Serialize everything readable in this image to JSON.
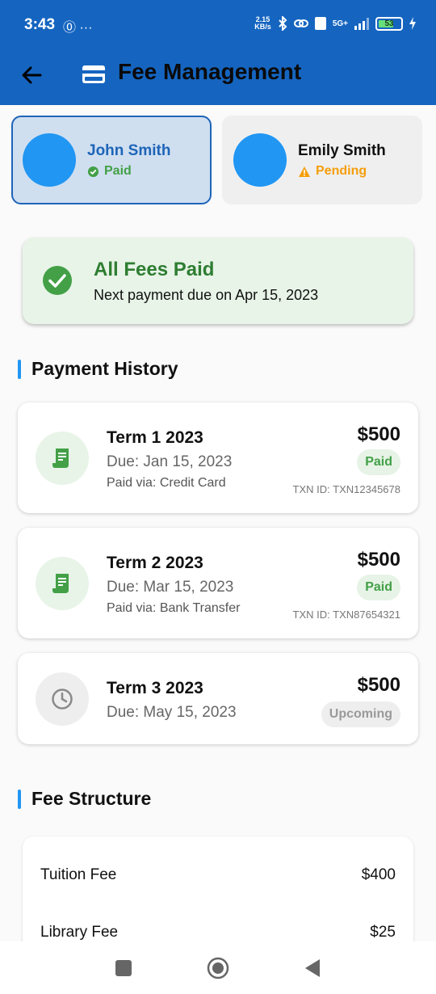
{
  "status_bar": {
    "time": "3:43",
    "left_icons": "⓪ ···",
    "net_speed_top": "2.15",
    "net_speed_bottom": "KB/s",
    "network": "5G+",
    "battery": "53"
  },
  "app_bar": {
    "title": "Fee Management",
    "back_icon": "arrow-left-icon",
    "title_icon": "credit-card-icon"
  },
  "students": [
    {
      "name": "John Smith",
      "status": "Paid",
      "selected": true
    },
    {
      "name": "Emily Smith",
      "status": "Pending",
      "selected": false
    }
  ],
  "summary": {
    "title": "All Fees Paid",
    "subtitle": "Next payment due on Apr 15, 2023"
  },
  "payment_history": {
    "heading": "Payment History",
    "items": [
      {
        "term": "Term 1 2023",
        "due": "Due: Jan 15, 2023",
        "via": "Paid via: Credit Card",
        "amount": "$500",
        "status": "Paid",
        "txn": "TXN ID: TXN12345678",
        "icon": "receipt-icon"
      },
      {
        "term": "Term 2 2023",
        "due": "Due: Mar 15, 2023",
        "via": "Paid via: Bank Transfer",
        "amount": "$500",
        "status": "Paid",
        "txn": "TXN ID: TXN87654321",
        "icon": "receipt-icon"
      },
      {
        "term": "Term 3 2023",
        "due": "Due: May 15, 2023",
        "amount": "$500",
        "status": "Upcoming",
        "icon": "clock-icon"
      }
    ]
  },
  "fee_structure": {
    "heading": "Fee Structure",
    "items": [
      {
        "label": "Tuition Fee",
        "amount": "$400"
      },
      {
        "label": "Library Fee",
        "amount": "$25"
      }
    ]
  },
  "colors": {
    "primary": "#1565c0",
    "accent": "#2196f3",
    "success": "#43a047",
    "warning": "#f59e0b"
  }
}
